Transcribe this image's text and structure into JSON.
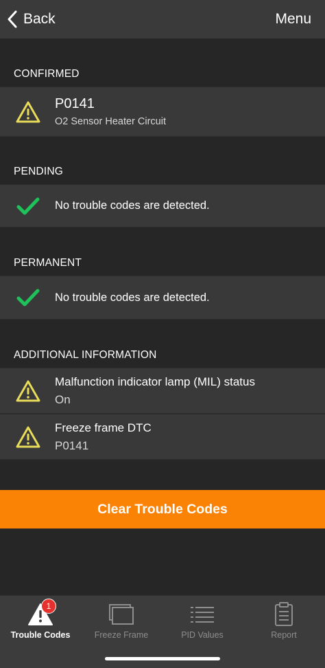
{
  "nav": {
    "back_label": "Back",
    "menu_label": "Menu"
  },
  "sections": {
    "confirmed": {
      "header": "CONFIRMED",
      "code": "P0141",
      "description": "O2 Sensor Heater Circuit"
    },
    "pending": {
      "header": "PENDING",
      "message": "No trouble codes are detected."
    },
    "permanent": {
      "header": "PERMANENT",
      "message": "No trouble codes are detected."
    },
    "additional": {
      "header": "ADDITIONAL INFORMATION",
      "items": [
        {
          "label": "Malfunction indicator lamp (MIL) status",
          "value": "On"
        },
        {
          "label": "Freeze frame DTC",
          "value": "P0141"
        }
      ]
    }
  },
  "actions": {
    "clear_label": "Clear Trouble Codes"
  },
  "tabbar": {
    "tabs": [
      {
        "label": "Trouble Codes",
        "icon": "warning-icon",
        "badge": "1",
        "active": true
      },
      {
        "label": "Freeze Frame",
        "icon": "freeze-frame-icon",
        "active": false
      },
      {
        "label": "PID Values",
        "icon": "list-icon",
        "active": false
      },
      {
        "label": "Report",
        "icon": "clipboard-icon",
        "active": false
      }
    ]
  },
  "colors": {
    "accent": "#fa8306",
    "warning": "#e8dc5a",
    "success": "#1fc15a",
    "badge": "#e5322d",
    "background": "#262626",
    "row": "#393939"
  }
}
